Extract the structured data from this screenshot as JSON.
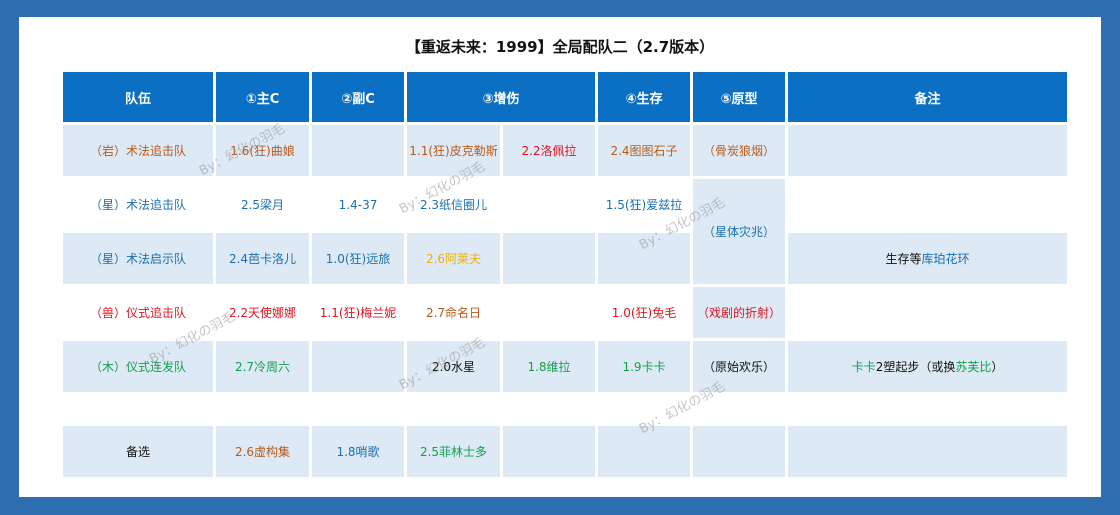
{
  "title": "【重返未来：1999】全局配队二（2.7版本）",
  "headers": [
    "队伍",
    "①主C",
    "②副C",
    "③增伤",
    "④生存",
    "⑤原型",
    "备注"
  ],
  "rows": [
    {
      "team": "（岩）术法追击队",
      "main_c": "1.6(狂)曲娘",
      "sub_c": "",
      "buff1": "1.1(狂)皮克勒斯",
      "buff2": "2.2洛佩拉",
      "survival": "2.4图图石子",
      "arcanum": "（骨炭狼烟）",
      "note": ""
    },
    {
      "team": "（星）术法追击队",
      "main_c": "2.5梁月",
      "sub_c": "1.4-37",
      "buff1": "2.3纸信圈儿",
      "buff2": "",
      "survival": "1.5(狂)爱兹拉"
    },
    {
      "team": "（星）术法启示队",
      "main_c": "2.4芭卡洛儿",
      "sub_c": "1.0(狂)远旅",
      "buff1": "2.6阿莱夫",
      "buff2": "",
      "survival": ""
    },
    {
      "team": "（兽）仪式追击队",
      "main_c": "2.2天使娜娜",
      "sub_c": "1.1(狂)梅兰妮",
      "buff1": "2.7命名日",
      "buff2": "",
      "survival": "1.0(狂)兔毛",
      "arcanum": "（戏剧的折射）"
    },
    {
      "team": "（木）仪式连发队",
      "main_c": "2.7冷周六",
      "sub_c": "",
      "buff1": "2.0水星",
      "buff2": "1.8维拉",
      "survival": "1.9卡卡",
      "arcanum": "（原始欢乐）"
    },
    {
      "team": "备选",
      "main_c": "2.6虚构集",
      "sub_c": "1.8哨歌",
      "buff1": "2.5菲林士多",
      "buff2": "",
      "survival": "",
      "arcanum": "",
      "note": ""
    }
  ],
  "merged": {
    "arcanum_star": "（星体灾兆）",
    "note_survival_prefix": "生存等",
    "note_survival_item": "库珀花环",
    "note_woods_part1": "卡卡",
    "note_woods_part2": "2塑起步（或换",
    "note_woods_part3": "苏芙比",
    "note_woods_part4": "）"
  },
  "watermark": "By：幻化の羽毛",
  "colors": {
    "background": "#2e6db0",
    "header": "#0b6fc4",
    "shade": "#dde9f5",
    "rock": "#b85a1a",
    "star": "#1a6fb0",
    "beast": "#e0141e",
    "plant": "#13a04b",
    "gold": "#e9b114"
  }
}
